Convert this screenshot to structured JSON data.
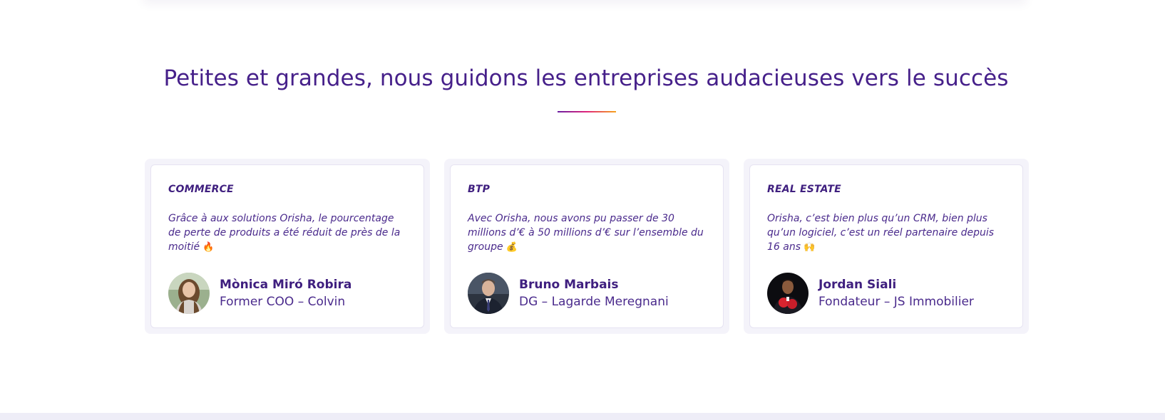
{
  "section": {
    "title": "Petites et grandes, nous guidons les entreprises audacieuses vers le succès"
  },
  "testimonials": [
    {
      "sector": "COMMERCE",
      "quote": "Grâce à aux solutions Orisha, le pourcentage de perte de produits a été réduit de près de la moitié",
      "emoji": "🔥",
      "name": "Mònica Miró Robira",
      "role": "Former COO – Colvin",
      "avatar_icon": "portrait-woman-avatar"
    },
    {
      "sector": "BTP",
      "quote": "Avec Orisha, nous avons pu passer de 30 millions d’€ à 50 millions d’€ sur l’ensemble du groupe",
      "emoji": "💰",
      "name": "Bruno Marbais",
      "role": "DG – Lagarde Meregnani",
      "avatar_icon": "portrait-man-suit-avatar"
    },
    {
      "sector": "REAL ESTATE",
      "quote": "Orisha, c’est bien plus qu’un CRM, bien plus qu’un logiciel, c’est un réel partenaire depuis 16 ans",
      "emoji": "🙌",
      "name": "Jordan Siali",
      "role": "Fondateur – JS Immobilier",
      "avatar_icon": "portrait-man-boxing-avatar"
    }
  ],
  "colors": {
    "primary": "#3f1f7f",
    "card_frame": "#f4f3fa",
    "underline_gradient": [
      "#6a1fa1",
      "#e0247a",
      "#f6a31c"
    ]
  }
}
